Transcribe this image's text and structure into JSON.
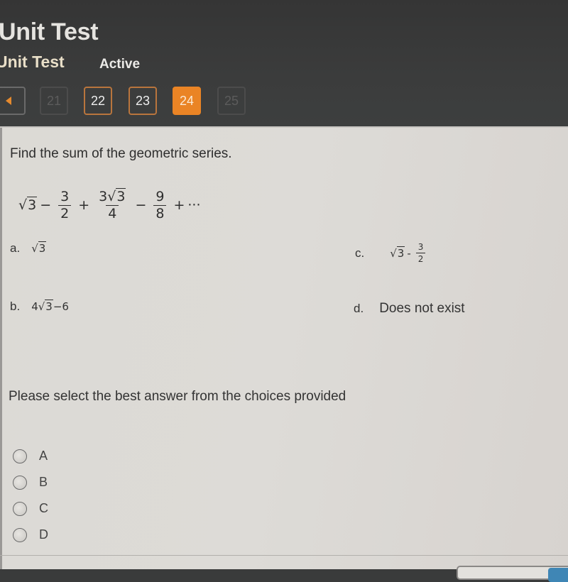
{
  "header": {
    "title": "Unit Test",
    "subtitle": "Unit Test",
    "status": "Active"
  },
  "pager": {
    "prev_icon": "triangle-left-icon",
    "pages": [
      {
        "label": "21",
        "state": "disabled"
      },
      {
        "label": "22",
        "state": "visited"
      },
      {
        "label": "23",
        "state": "visited"
      },
      {
        "label": "24",
        "state": "current"
      },
      {
        "label": "25",
        "state": "disabled"
      }
    ],
    "accent_color": "#ea8425"
  },
  "question": {
    "prompt": "Find the sum of the geometric series.",
    "series": {
      "term1": "√3",
      "term1_radicand": "3",
      "op1": "−",
      "term2_num": "3",
      "term2_den": "2",
      "op2": "+",
      "term3_num_coef": "3",
      "term3_num_radicand": "3",
      "term3_den": "4",
      "op3": "−",
      "term4_num": "9",
      "term4_den": "8",
      "op4": "+",
      "ellipsis": "···"
    },
    "options": [
      {
        "letter": "a.",
        "text": "√3",
        "radicand": "3"
      },
      {
        "letter": "b.",
        "text": "4√3 − 6",
        "coef": "4",
        "radicand": "3",
        "rest": "−6"
      },
      {
        "letter": "c.",
        "text": "√3 − 3/2",
        "radicand": "3",
        "op": "-",
        "num": "3",
        "den": "2"
      },
      {
        "letter": "d.",
        "text": "Does not exist"
      }
    ]
  },
  "answer": {
    "instruction": "Please select the best answer from the choices provided",
    "choices": [
      "A",
      "B",
      "C",
      "D"
    ],
    "selected": null
  }
}
